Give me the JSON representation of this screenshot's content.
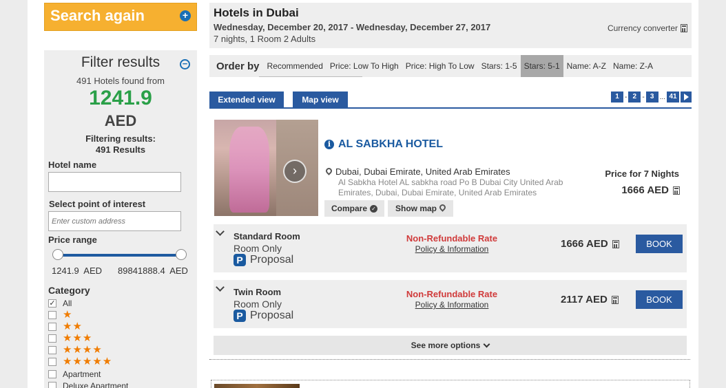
{
  "search_again": {
    "label": "Search again"
  },
  "filter": {
    "title": "Filter results",
    "found_text": "491 Hotels found from",
    "min_price": "1241.9",
    "currency": "AED",
    "filtering_label": "Filtering results:",
    "filtering_count": "491 Results",
    "hotel_name_label": "Hotel name",
    "hotel_name_value": "",
    "poi_label": "Select point of interest",
    "poi_placeholder": "Enter custom address",
    "price_range_label": "Price range",
    "price_min": "1241.9",
    "price_max": "89841888.4",
    "price_currency": "AED",
    "category_label": "Category",
    "categories": [
      {
        "label": "All",
        "checked": true
      },
      {
        "stars": "★",
        "checked": false
      },
      {
        "stars": "★★",
        "checked": false
      },
      {
        "stars": "★★★",
        "checked": false
      },
      {
        "stars": "★★★★",
        "checked": false
      },
      {
        "stars": "★★★★★",
        "checked": false
      },
      {
        "label": "Apartment",
        "checked": false
      },
      {
        "label": "Deluxe Apartment",
        "checked": false
      }
    ]
  },
  "header": {
    "title": "Hotels in Dubai",
    "dates": "Wednesday, December 20, 2017 - Wednesday, December 27, 2017",
    "stay": "7 nights, 1 Room 2 Adults",
    "currency_converter": "Currency converter"
  },
  "order_by": {
    "label": "Order by",
    "options": [
      "Recommended",
      "Price: Low To High",
      "Price: High To Low",
      "Stars: 1-5",
      "Stars: 5-1",
      "Name: A-Z",
      "Name: Z-A"
    ],
    "active": "Stars: 5-1"
  },
  "views": {
    "extended": "Extended view",
    "map": "Map view"
  },
  "pagination": {
    "pages": [
      "1",
      "2",
      "3",
      "41"
    ],
    "separator_dash": "-",
    "ellipsis": "..."
  },
  "hotel": {
    "name": "AL SABKHA HOTEL",
    "location": "Dubai, Dubai Emirate, United Arab Emirates",
    "address": "Al Sabkha Hotel AL sabkha road Po B Dubai City United Arab Emirates, Dubai, Dubai Emirate, United Arab Emirates",
    "compare_label": "Compare",
    "show_map_label": "Show map",
    "price_label": "Price for 7 Nights",
    "price": "1666 AED",
    "rooms": [
      {
        "name": "Standard Room",
        "board": "Room Only",
        "proposal": "Proposal",
        "rate": "Non-Refundable Rate",
        "policy": "Policy & Information",
        "price": "1666 AED",
        "book": "BOOK"
      },
      {
        "name": "Twin Room",
        "board": "Room Only",
        "proposal": "Proposal",
        "rate": "Non-Refundable Rate",
        "policy": "Policy & Information",
        "price": "2117 AED",
        "book": "BOOK"
      }
    ],
    "see_more": "See more options"
  },
  "colors": {
    "accent": "#2a5aa0",
    "search_btn": "#f6b030",
    "price_green": "#2aa048",
    "rate_red": "#d03a3a",
    "star_orange": "#f07c00"
  }
}
